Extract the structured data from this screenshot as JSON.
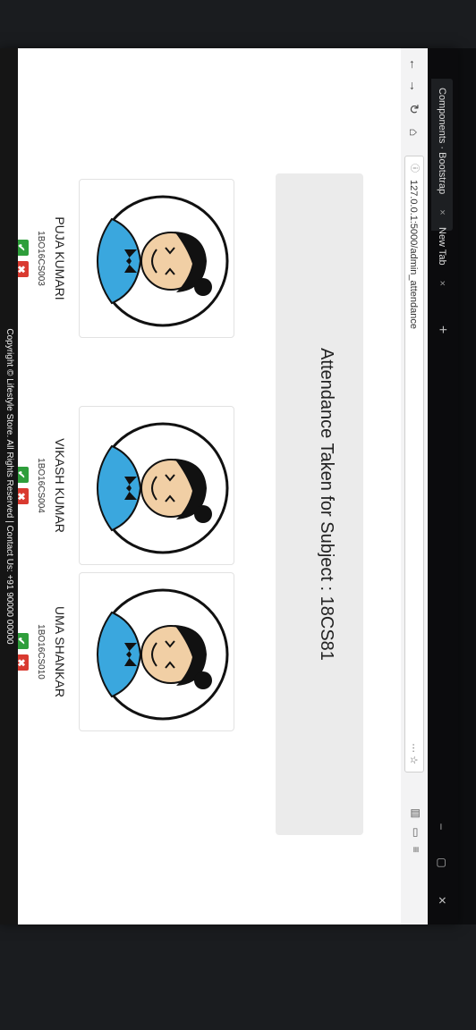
{
  "browser": {
    "tabs": [
      {
        "label": "Components · Bootstrap",
        "close": "×"
      },
      {
        "label": "New Tab",
        "close": "×"
      }
    ],
    "new_tab_symbol": "+",
    "url": "127.0.0.1:5000/admin_attendance"
  },
  "page": {
    "subject_title": "Attendance Taken for Subject : 18CS81",
    "students": [
      {
        "name": "PUJA KUMARI",
        "usn": "1BO16CS003"
      },
      {
        "name": "VIKASH KUMAR",
        "usn": "1BO16CS004"
      },
      {
        "name": "UMA SHANKAR",
        "usn": "1BO16CS010"
      }
    ],
    "present_symbol": "✔",
    "absent_symbol": "✖",
    "footer": "Copyright © Lifestyle Store. All Rights Reserved | Contact Us: +91 90000 00000"
  },
  "colors": {
    "present": "#2e9e3b",
    "absent": "#d93a30",
    "jumbotron": "#ebebeb",
    "avatar_shirt": "#3aa7de"
  },
  "icons": [
    "back-icon",
    "forward-icon",
    "reload-icon",
    "home-icon",
    "lock-icon",
    "bookmark-icon",
    "library-icon",
    "menu-icon",
    "avatar-icon"
  ]
}
